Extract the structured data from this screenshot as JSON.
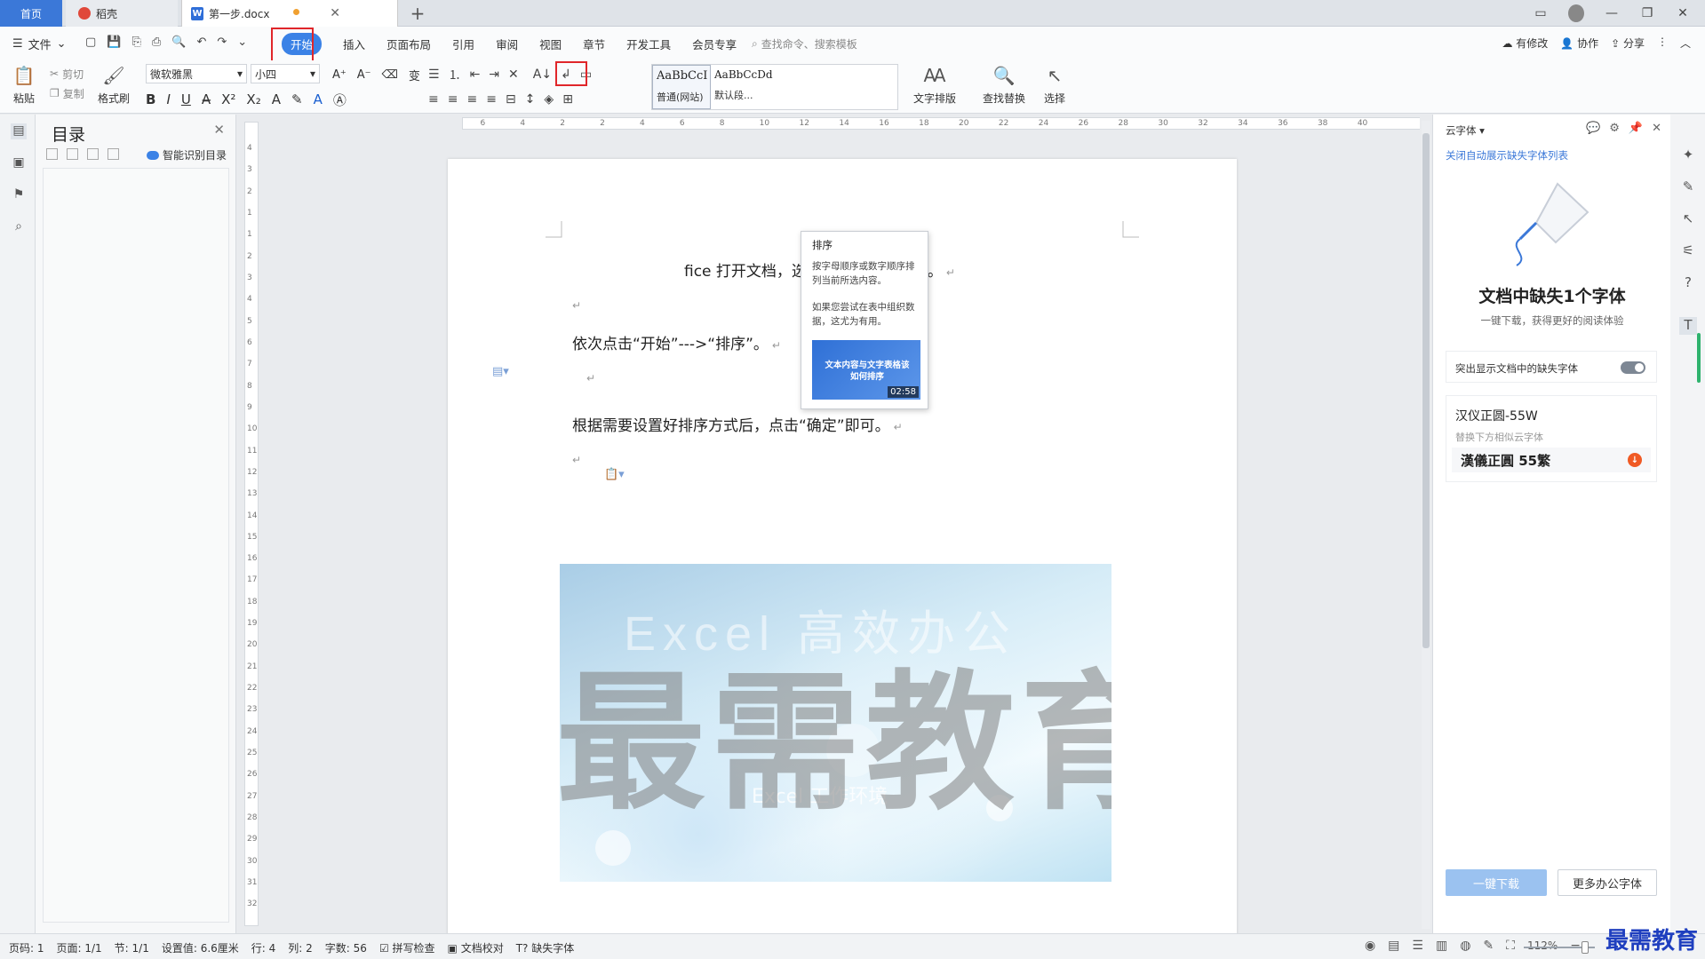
{
  "tabs": {
    "home": "首页",
    "docer": "稻壳",
    "doc": "第一步.docx",
    "new": "+"
  },
  "menu": {
    "file": "文件",
    "tabs": [
      "开始",
      "插入",
      "页面布局",
      "引用",
      "审阅",
      "视图",
      "章节",
      "开发工具",
      "会员专享"
    ],
    "search_placeholder": "查找命令、搜索模板",
    "right": [
      "有修改",
      "协作",
      "分享"
    ]
  },
  "ribbon": {
    "paste": "粘贴",
    "cut": "剪切",
    "copy": "复制",
    "format_painter": "格式刷",
    "font_name": "微软雅黑",
    "font_size": "小四",
    "styles": [
      {
        "sample": "AaBbCcI",
        "caption": "普通(网站)"
      },
      {
        "sample": "AaBbCcDd",
        "caption": "默认段..."
      }
    ],
    "text_layout": "文字排版",
    "find_replace": "查找替换",
    "select": "选择"
  },
  "toc": {
    "title": "目录",
    "smart": "智能识别目录"
  },
  "tooltip": {
    "title": "排序",
    "text1": "按字母顺序或数字顺序排列当前所选内容。",
    "text2": "如果您尝试在表中组织数据，这尤为有用。",
    "video_title": "文本内容与文字表格该如何排序",
    "duration": "02:58"
  },
  "document": {
    "line1": "fice 打开文档，选中需要操作的内容。",
    "line2": "依次点击“开始”--->“排序”。",
    "line3": "根据需要设置好排序方式后，点击“确定”即可。",
    "image_top": "Excel 高效办公",
    "image_bottom": "Excel 工作环境",
    "watermark": "最需教育"
  },
  "hruler_ticks": [
    "6",
    "4",
    "2",
    "2",
    "4",
    "6",
    "8",
    "10",
    "12",
    "14",
    "16",
    "18",
    "20",
    "22",
    "24",
    "26",
    "28",
    "30",
    "32",
    "34",
    "36",
    "38",
    "40"
  ],
  "vruler_ticks": [
    "4",
    "3",
    "2",
    "1",
    "1",
    "2",
    "3",
    "4",
    "5",
    "6",
    "7",
    "8",
    "9",
    "10",
    "11",
    "12",
    "13",
    "14",
    "15",
    "16",
    "17",
    "18",
    "19",
    "20",
    "21",
    "22",
    "23",
    "24",
    "25",
    "26",
    "27",
    "28",
    "29",
    "30",
    "31",
    "32"
  ],
  "right_panel": {
    "header": "云字体",
    "link": "关闭自动展示缺失字体列表",
    "big": "文档中缺失1个字体",
    "sub": "一键下载，获得更好的阅读体验",
    "highlight_label": "突出显示文档中的缺失字体",
    "font_missing": "汉仪正圆-55W",
    "font_replace_hint": "替换下方相似云字体",
    "font_sample": "漢儀正圓 55繁",
    "btn_download": "一键下载",
    "btn_more": "更多办公字体"
  },
  "status": {
    "page_no": "页码: 1",
    "pages": "页面: 1/1",
    "section": "节: 1/1",
    "setting": "设置值: 6.6厘米",
    "row": "行: 4",
    "col": "列: 2",
    "words": "字数: 56",
    "spell": "拼写检查",
    "proof": "文档校对",
    "missing_font": "缺失字体",
    "zoom": "112%"
  },
  "logo": "最需教育"
}
